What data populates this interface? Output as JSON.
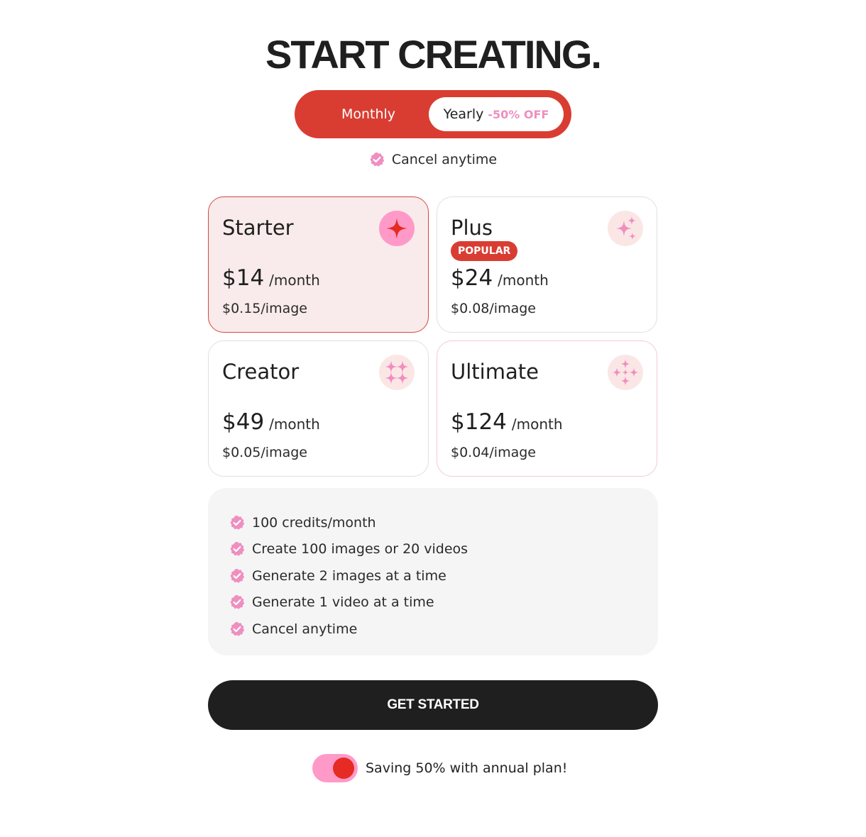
{
  "header": {
    "title": "START CREATING."
  },
  "billing_toggle": {
    "monthly_label": "Monthly",
    "yearly_label": "Yearly",
    "yearly_discount": "-50% OFF",
    "selected": "Yearly"
  },
  "cancel_note": "Cancel anytime",
  "plans": [
    {
      "name": "Starter",
      "price": "$14",
      "period": "/month",
      "per_image": "$0.15/image",
      "icon": "sparkle-1-icon",
      "selected": true
    },
    {
      "name": "Plus",
      "badge": "POPULAR",
      "price": "$24",
      "period": "/month",
      "per_image": "$0.08/image",
      "icon": "sparkle-2-icon"
    },
    {
      "name": "Creator",
      "price": "$49",
      "period": "/month",
      "per_image": "$0.05/image",
      "icon": "sparkle-4-icon"
    },
    {
      "name": "Ultimate",
      "price": "$124",
      "period": "/month",
      "per_image": "$0.04/image",
      "icon": "sparkle-5-icon"
    }
  ],
  "features": [
    "100 credits/month",
    "Create 100 images or 20 videos",
    "Generate 2 images at a time",
    "Generate 1 video at a time",
    "Cancel anytime"
  ],
  "cta_label": "GET STARTED",
  "annual_switch": {
    "label": "Saving 50% with annual plan!",
    "on": true
  },
  "colors": {
    "accent_red": "#d93d32",
    "pink": "#ff99c8",
    "pink_text": "#ef8fbf",
    "dark": "#1f1f1f",
    "card_selected_bg": "#f9ebeb",
    "features_bg": "#f5f5f5"
  }
}
